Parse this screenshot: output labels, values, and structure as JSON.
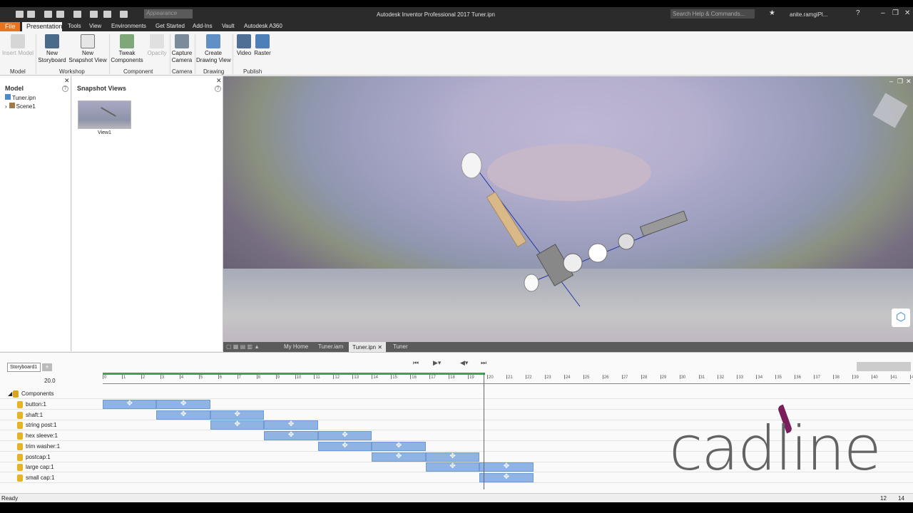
{
  "app": {
    "title": "Autodesk Inventor Professional 2017   Tuner.ipn",
    "appearance_placeholder": "Appearance",
    "search_placeholder": "Search Help & Commands...",
    "user": "anite.ramgiPl...",
    "menu": [
      "File",
      "Presentation",
      "Tools",
      "View",
      "Environments",
      "Get Started",
      "Add-Ins",
      "Vault",
      "Autodesk A360"
    ]
  },
  "ribbon": {
    "buttons": [
      {
        "label": "Insert Model",
        "disabled": true
      },
      {
        "label": "New\nStoryboard"
      },
      {
        "label": "New\nSnapshot View"
      },
      {
        "label": "Tweak\nComponents"
      },
      {
        "label": "Opacity",
        "disabled": true
      },
      {
        "label": "Capture\nCamera"
      },
      {
        "label": "Create\nDrawing View"
      },
      {
        "label": "Video"
      },
      {
        "label": "Raster"
      }
    ],
    "groups": [
      "Model",
      "Workshop",
      "Component",
      "Camera",
      "Drawing",
      "Publish"
    ]
  },
  "model_panel": {
    "title": "Model",
    "tree": [
      "Tuner.ipn",
      "Scene1"
    ]
  },
  "snapshot_panel": {
    "title": "Snapshot Views",
    "view_label": "View1"
  },
  "doc_tabs": [
    "My Home",
    "Tuner.iam",
    "Tuner.ipn",
    "Tuner"
  ],
  "storyboard": {
    "tab": "Storyboard1",
    "time": "20.0",
    "root": "Components",
    "components": [
      {
        "name": "button:1",
        "start": 0,
        "end": 5
      },
      {
        "name": "shaft:1",
        "start": 2.5,
        "end": 7.5
      },
      {
        "name": "string post:1",
        "start": 5,
        "end": 10
      },
      {
        "name": "hex sleeve:1",
        "start": 7.5,
        "end": 12.5
      },
      {
        "name": "trim washer:1",
        "start": 10,
        "end": 15
      },
      {
        "name": "postcap:1",
        "start": 12.5,
        "end": 17.5
      },
      {
        "name": "large cap:1",
        "start": 15,
        "end": 20
      },
      {
        "name": "small cap:1",
        "start": 17.5,
        "end": 20
      }
    ],
    "ruler_max": 42
  },
  "status": {
    "text": "Ready",
    "right_a": "12",
    "right_b": "14"
  },
  "watermark": "cadline"
}
